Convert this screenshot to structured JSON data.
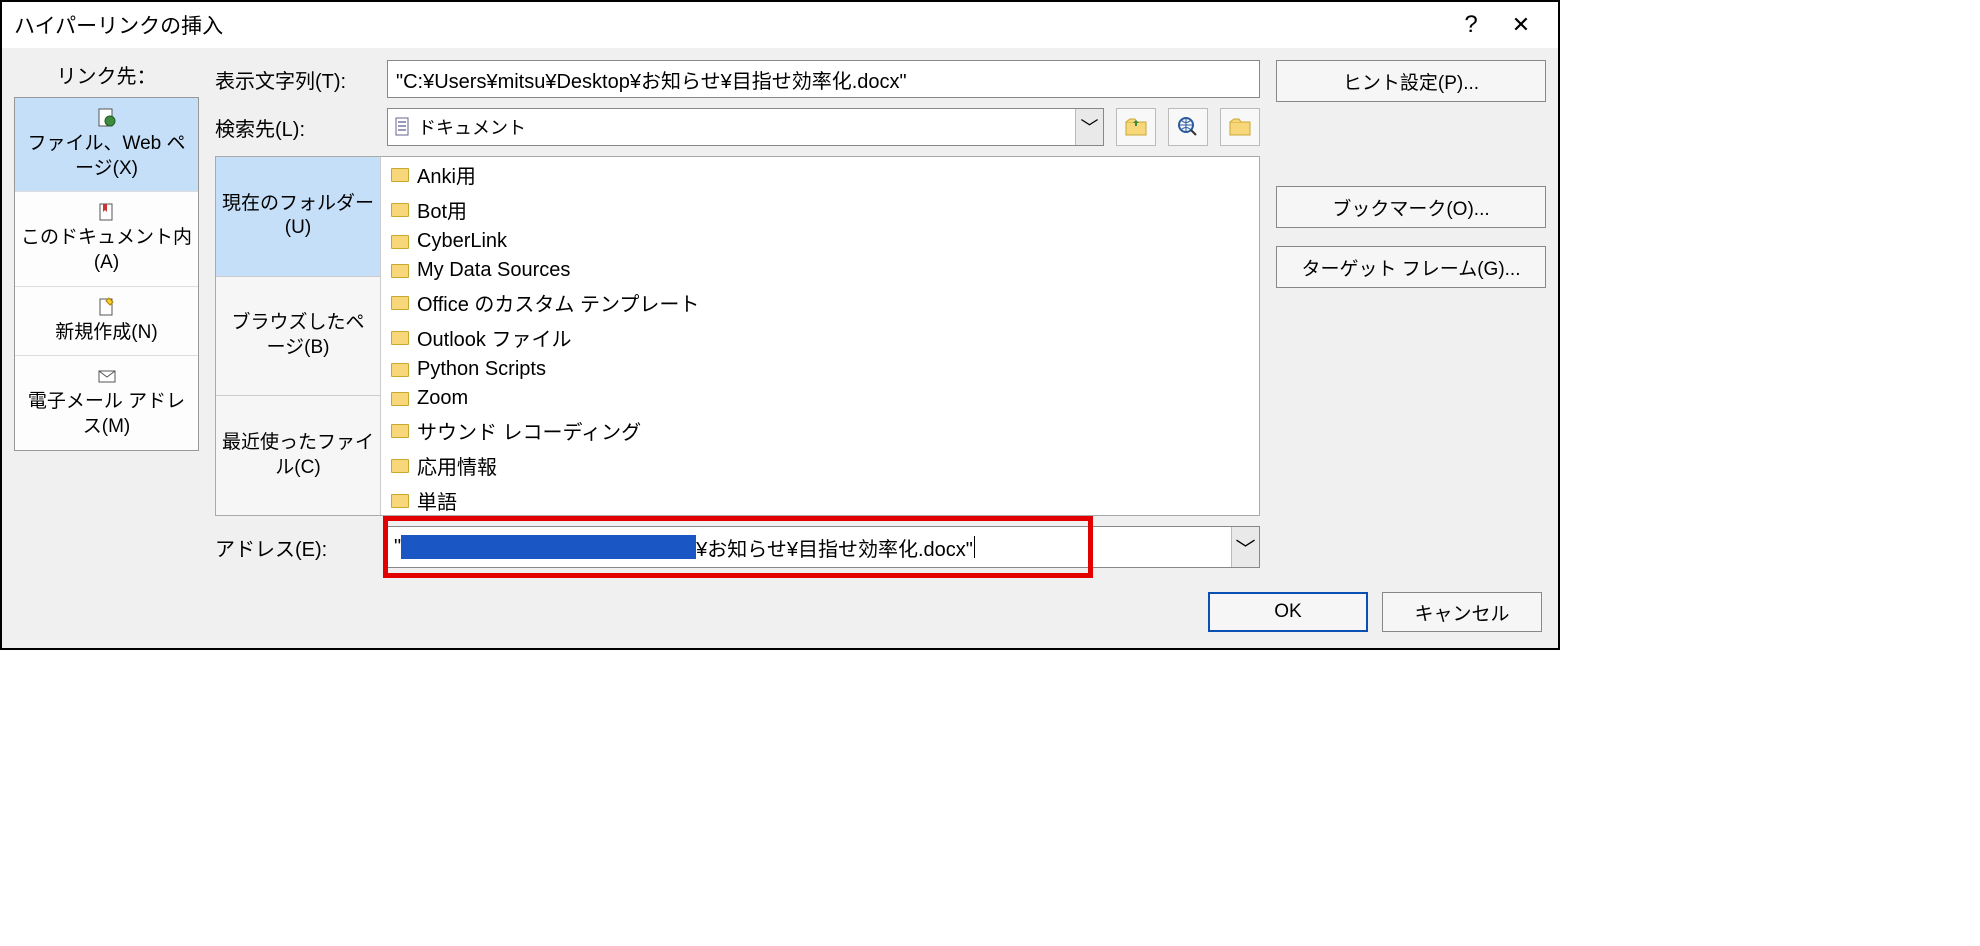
{
  "title": "ハイパーリンクの挿入",
  "link_to_label": "リンク先：",
  "link_to": {
    "item0": "ファイル、Web ページ(X)",
    "item1": "このドキュメント内(A)",
    "item2": "新規作成(N)",
    "item3": "電子メール アドレス(M)"
  },
  "display_text": {
    "label": "表示文字列(T):",
    "value": "\"C:¥Users¥mitsu¥Desktop¥お知らせ¥目指せ効率化.docx\""
  },
  "look_in": {
    "label": "検索先(L):",
    "value": "ドキュメント"
  },
  "browse_tabs": {
    "t0": "現在のフォルダー(U)",
    "t1": "ブラウズしたページ(B)",
    "t2": "最近使ったファイル(C)"
  },
  "files": {
    "f0": "Anki用",
    "f1": "Bot用",
    "f2": "CyberLink",
    "f3": "My Data Sources",
    "f4": "Office のカスタム テンプレート",
    "f5": "Outlook ファイル",
    "f6": "Python Scripts",
    "f7": "Zoom",
    "f8": "サウンド レコーディング",
    "f9": "応用情報",
    "f10": "単語"
  },
  "address": {
    "label": "アドレス(E):",
    "visible_suffix": "¥お知らせ¥目指せ効率化.docx\""
  },
  "buttons": {
    "hint": "ヒント設定(P)...",
    "bookmark": "ブックマーク(O)...",
    "target_frame": "ターゲット フレーム(G)...",
    "ok": "OK",
    "cancel": "キャンセル"
  }
}
